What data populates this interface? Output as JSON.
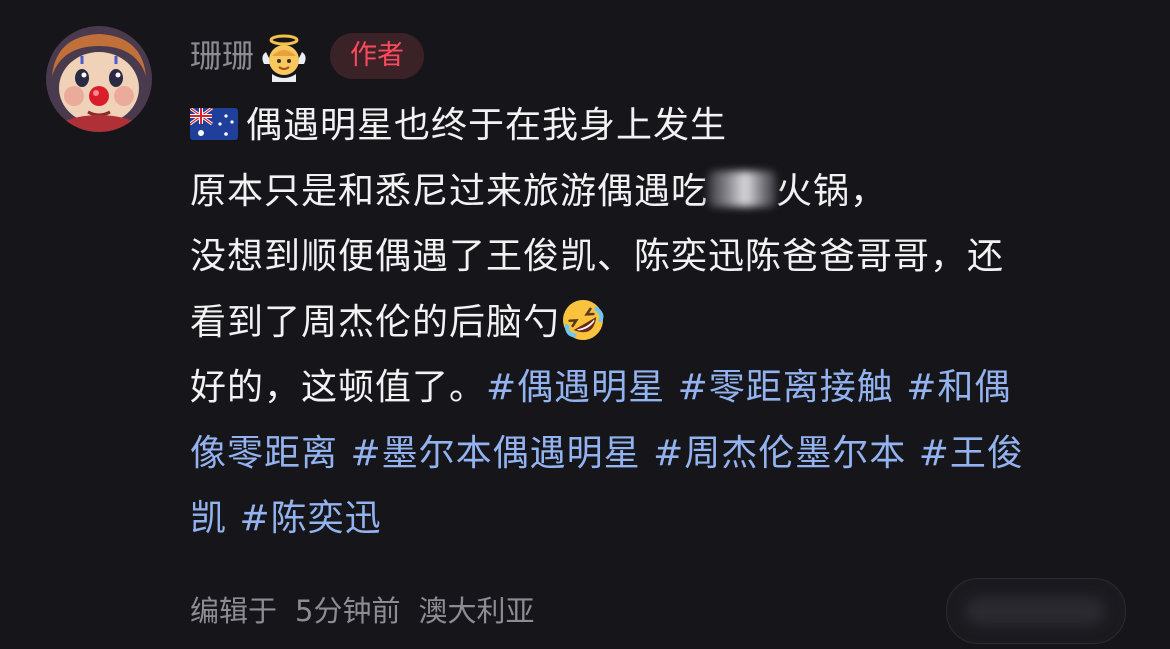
{
  "user": {
    "name": "珊珊",
    "author_badge": "作者",
    "avatar_icon": "clown-doll-avatar",
    "decoration_icon": "angel-emoji"
  },
  "post": {
    "line1": "偶遇明星也终于在我身上发生",
    "line2_before": "原本只是和悉尼过来旅游偶遇吃",
    "line2_after": "火锅，",
    "line3": "没想到顺便偶遇了王俊凯、陈奕迅陈爸爸哥哥，还",
    "line4": "看到了周杰伦的后脑勺",
    "line5_text": "好的，这顿值了。",
    "hashtags": [
      "#偶遇明星",
      "#零距离接触",
      "#和偶像零距离",
      "#墨尔本偶遇明星",
      "#周杰伦墨尔本",
      "#王俊凯",
      "#陈奕迅"
    ],
    "hashtag_fragments": {
      "l5a": "#偶遇明星",
      "l5b": "#零距离接触",
      "l5c": "#和偶",
      "l6a": "像零距离",
      "l6b": "#墨尔本偶遇明星",
      "l6c": "#周杰伦墨尔本",
      "l6d": "#王俊",
      "l7a": "凯",
      "l7b": "#陈奕迅"
    },
    "flag_icon": "australia-flag-icon",
    "laugh_icon": "rolling-laughing-emoji"
  },
  "meta": {
    "edited": "编辑于",
    "time": "5分钟前",
    "location": "澳大利亚"
  },
  "colors": {
    "background": "#161519",
    "text": "#f2f2f4",
    "muted": "#8d8c92",
    "hashtag": "#93b3f0",
    "badge_text": "#ff4a5e",
    "badge_bg": "#3b2226"
  }
}
